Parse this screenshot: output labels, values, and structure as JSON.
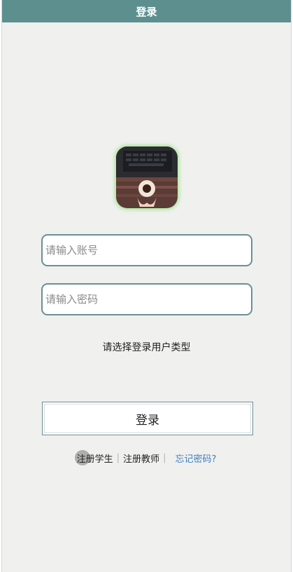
{
  "header": {
    "title": "登录"
  },
  "form": {
    "account_placeholder": "请输入账号",
    "password_placeholder": "请输入密码",
    "user_type_prompt": "请选择登录用户类型",
    "login_label": "登录"
  },
  "links": {
    "register_student": "注册学生",
    "register_teacher": "注册教师",
    "forgot_password": "忘记密码?",
    "separator": "|"
  },
  "colors": {
    "header_bg": "#5e8f8f",
    "field_border": "#6c8f94",
    "link_blue": "#3d7fc1",
    "avatar_glow": "#a5e493"
  },
  "icons": {
    "avatar": "avatar-photo"
  }
}
